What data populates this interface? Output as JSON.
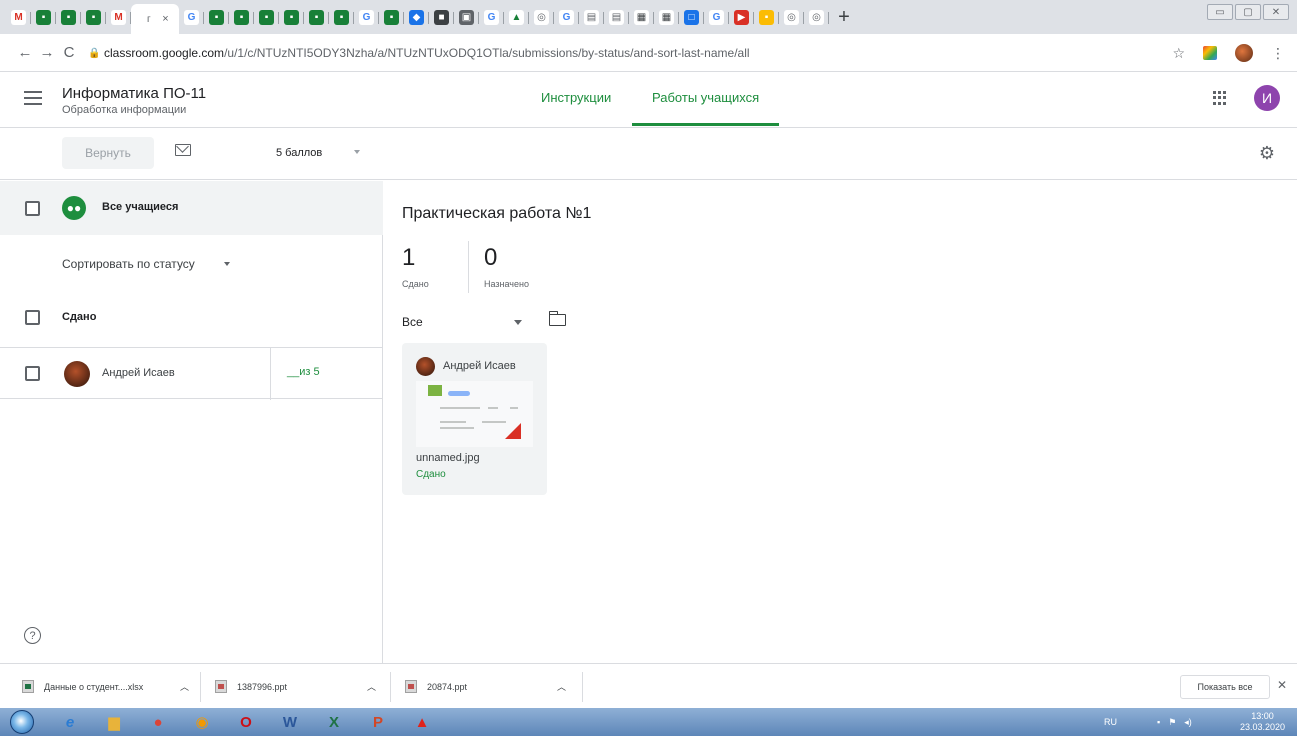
{
  "browser": {
    "tab_close": "×",
    "new_tab": "+",
    "window_controls": [
      "▭",
      "▢",
      "✕"
    ],
    "url_host": "classroom.google.com",
    "url_path": "/u/1/c/NTUzNTI5ODY3Nzha/a/NTUzNTUxODQ1OTla/submissions/by-status/and-sort-last-name/all",
    "star": "☆",
    "menu": "⋮",
    "back": "←",
    "forward": "→",
    "reload": "C"
  },
  "header": {
    "course_title": "Информатика ПО-11",
    "course_subtitle": "Обработка информации",
    "tab_instructions": "Инструкции",
    "tab_student_work": "Работы учащихся",
    "avatar_letter": "И"
  },
  "toolbar": {
    "return_label": "Вернуть",
    "points_value": "5 баллов"
  },
  "left": {
    "all_students": "Все учащиеся",
    "sort_label": "Сортировать по статусу",
    "section_done": "Сдано",
    "students": [
      {
        "name": "Андрей Исаев",
        "score": "__из 5"
      }
    ],
    "help": "?"
  },
  "assignment": {
    "title": "Практическая работа №1",
    "stats": [
      {
        "value": "1",
        "label": "Сдано"
      },
      {
        "value": "0",
        "label": "Назначено"
      }
    ],
    "filter": "Все",
    "card": {
      "student": "Андрей Исаев",
      "file": "unnamed.jpg",
      "status": "Сдано"
    }
  },
  "downloads": {
    "items": [
      {
        "name": "Данные о студент....xlsx"
      },
      {
        "name": "1387996.ppt"
      },
      {
        "name": "20874.ppt"
      }
    ],
    "show_all": "Показать все",
    "close": "✕"
  },
  "taskbar": {
    "lang": "RU",
    "time": "13:00",
    "date": "23.03.2020"
  },
  "colors": {
    "accent_green": "#1e8e3e",
    "avatar_purple": "#8e44ad"
  }
}
